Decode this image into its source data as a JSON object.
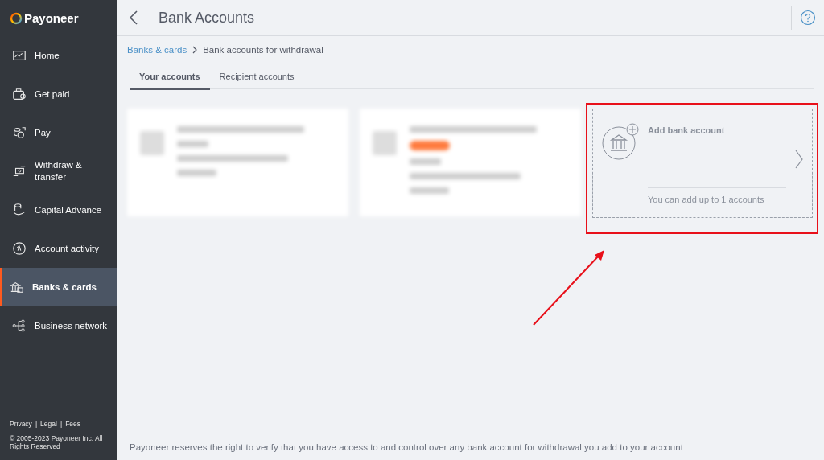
{
  "logo": {
    "text": "Payoneer"
  },
  "sidebar": {
    "items": [
      {
        "label": "Home",
        "kind": "chart",
        "selected": false
      },
      {
        "label": "Get paid",
        "kind": "wallet",
        "selected": false
      },
      {
        "label": "Pay",
        "kind": "coins",
        "selected": false
      },
      {
        "label": "Withdraw & transfer",
        "kind": "transfer",
        "selected": false
      },
      {
        "label": "Capital Advance",
        "kind": "hand",
        "selected": false
      },
      {
        "label": "Account activity",
        "kind": "activity",
        "selected": false
      },
      {
        "label": "Banks & cards",
        "kind": "bank",
        "selected": true
      },
      {
        "label": "Business network",
        "kind": "network",
        "selected": false
      }
    ],
    "links": [
      "Privacy",
      "Legal",
      "Fees"
    ],
    "separators": [
      "|",
      "|"
    ],
    "copyright": "© 2005-2023 Payoneer Inc. All Rights Reserved"
  },
  "header": {
    "title": "Bank Accounts"
  },
  "breadcrumb": {
    "link": "Banks & cards",
    "current": "Bank accounts for withdrawal"
  },
  "tabs": [
    {
      "label": "Your accounts",
      "selected": true
    },
    {
      "label": "Recipient accounts",
      "selected": false
    }
  ],
  "cards": [
    {
      "kind": "blurred",
      "badge": false
    },
    {
      "kind": "blurred",
      "badge": true
    },
    {
      "kind": "add",
      "title": "Add bank account",
      "note": "You can add up to 1 accounts"
    }
  ],
  "footer_note": "Payoneer reserves the right to verify that you have access to and control over any bank account for withdrawal you add to your account"
}
